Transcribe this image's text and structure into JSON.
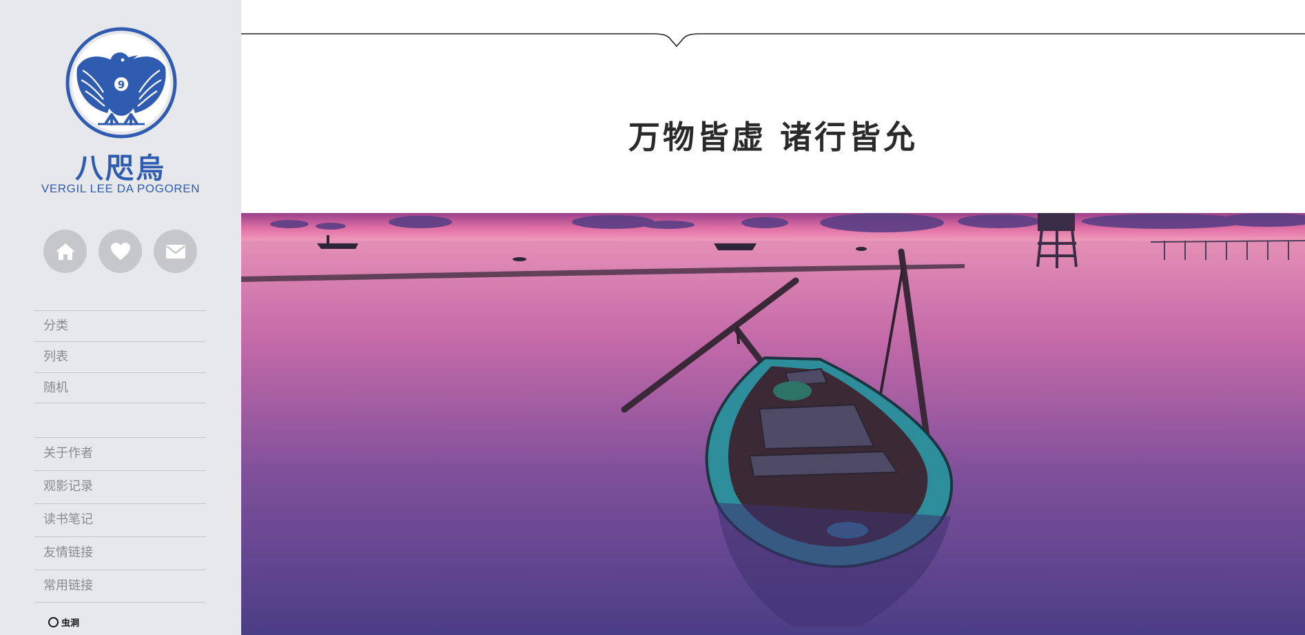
{
  "brand": {
    "name_cn": "八咫烏",
    "name_en": "VERGIL LEE DA POGOREN",
    "logo_icon": "crow-emblem-logo",
    "brand_color": "#2f5cb0"
  },
  "social": [
    {
      "icon": "home-icon"
    },
    {
      "icon": "heart-icon"
    },
    {
      "icon": "mail-icon"
    }
  ],
  "nav_primary": [
    {
      "label": "分类"
    },
    {
      "label": "列表"
    },
    {
      "label": "随机"
    }
  ],
  "nav_secondary": [
    {
      "label": "关于作者"
    },
    {
      "label": "观影记录"
    },
    {
      "label": "读书笔记"
    },
    {
      "label": "友情链接"
    },
    {
      "label": "常用链接"
    }
  ],
  "footer": {
    "badge_text": "虫洞"
  },
  "header": {
    "motto": "万物皆虚  诸行皆允"
  },
  "hero": {
    "image": "boat-at-sunset-lake"
  }
}
